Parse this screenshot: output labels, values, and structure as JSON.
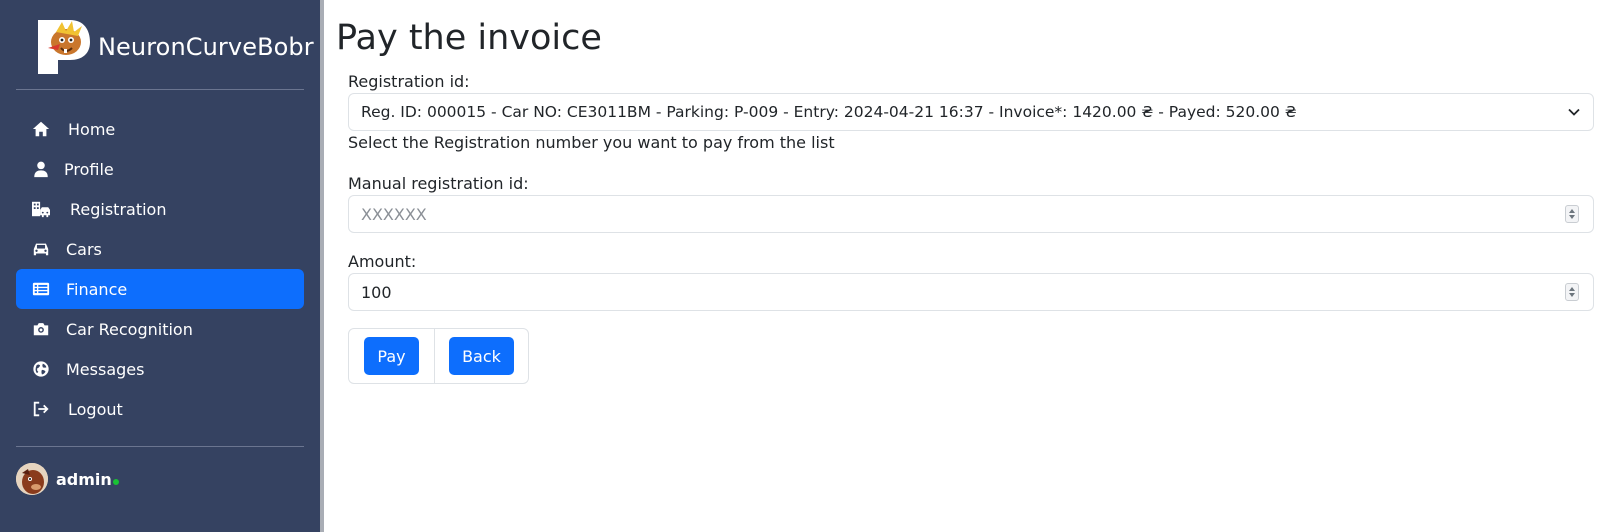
{
  "app": {
    "brand_name": "NeuronCurveBobr"
  },
  "sidebar": {
    "items": [
      {
        "label": "Home",
        "icon": "home-icon"
      },
      {
        "label": "Profile",
        "icon": "user-icon"
      },
      {
        "label": "Registration",
        "icon": "building-car-icon"
      },
      {
        "label": "Cars",
        "icon": "car-icon"
      },
      {
        "label": "Finance",
        "icon": "table-list-icon",
        "active": true
      },
      {
        "label": "Car Recognition",
        "icon": "camera-icon"
      },
      {
        "label": "Messages",
        "icon": "globe-icon"
      },
      {
        "label": "Logout",
        "icon": "logout-icon"
      }
    ],
    "user": {
      "name": "admin",
      "status_color": "#19c234"
    },
    "background_color": "#354261",
    "active_color": "#0d6efd"
  },
  "main": {
    "title": "Pay the invoice",
    "registration": {
      "label": "Registration id:",
      "selected": "Reg. ID: 000015 - Car NO: CE3011BM - Parking: P-009 - Entry: 2024-04-21 16:37 - Invoice*: 1420.00 ₴ - Payed: 520.00 ₴",
      "help": "Select the Registration number you want to pay from the list"
    },
    "manual": {
      "label": "Manual registration id:",
      "placeholder": "XXXXXX",
      "value": ""
    },
    "amount": {
      "label": "Amount:",
      "value": "100"
    },
    "buttons": {
      "pay": "Pay",
      "back": "Back"
    }
  }
}
